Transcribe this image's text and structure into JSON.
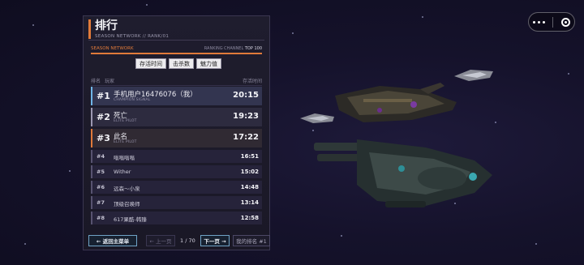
{
  "header": {
    "title": "排行",
    "subtitle": "SEASON NETWORK  //  RANK/01"
  },
  "info": {
    "network_label": "SEASON NETWORK",
    "channel_label": "RANKING CHANNEL",
    "channel_value": "TOP 100"
  },
  "sort_tabs": [
    "存活时间",
    "击杀数",
    "魅力值"
  ],
  "columns": {
    "rank": "排名",
    "player": "玩家",
    "time": "存活时间"
  },
  "rows": [
    {
      "rank": "#1",
      "name": "手机用户16476076（我）",
      "sub": "CHAMPION SIGNAL",
      "time": "20:15"
    },
    {
      "rank": "#2",
      "name": "死亡",
      "sub": "ELITE PILOT",
      "time": "19:23"
    },
    {
      "rank": "#3",
      "name": "此名",
      "sub": "ELITE PILOT",
      "time": "17:22"
    },
    {
      "rank": "#4",
      "name": "嗡嗡嗡嗡",
      "time": "16:51"
    },
    {
      "rank": "#5",
      "name": "Wither",
      "time": "15:02"
    },
    {
      "rank": "#6",
      "name": "远森～小泉",
      "time": "14:48"
    },
    {
      "rank": "#7",
      "name": "顶级召唤师",
      "time": "13:14"
    },
    {
      "rank": "#8",
      "name": "617果酷-韩臻",
      "time": "12:58"
    }
  ],
  "footer": {
    "back": "← 返回主菜单",
    "prev": "← 上一页",
    "page": "1 / 70",
    "next": "下一页 →",
    "my_rank": "我的排名 #1"
  },
  "icons": {
    "more": "more-dots-icon",
    "close": "target-close-icon"
  },
  "colors": {
    "accent": "#e07a3a",
    "first_place": "#6fb5e8",
    "background": "#15122b"
  }
}
